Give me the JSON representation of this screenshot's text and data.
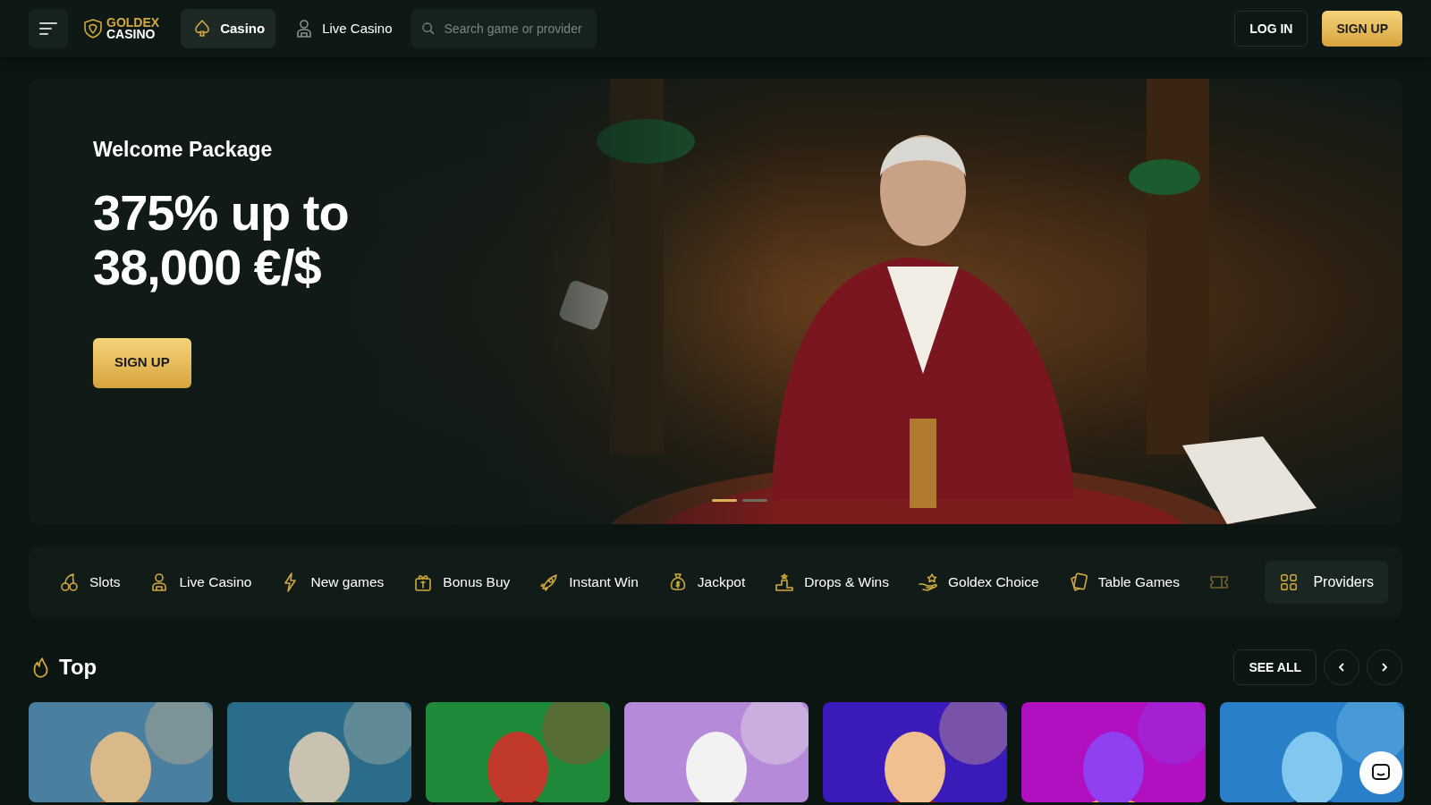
{
  "header": {
    "logo": {
      "line_1": "GOLDEX",
      "line_2": "CASINO"
    },
    "nav": [
      {
        "label": "Casino",
        "selected": true
      },
      {
        "label": "Live Casino",
        "selected": false
      }
    ],
    "search": {
      "placeholder": "Search game or provider"
    },
    "buttons": {
      "login": "LOG IN",
      "signup": "SIGN UP"
    }
  },
  "hero": {
    "eyebrow": "Welcome Package",
    "headline": "375% up to 38,000 €/$",
    "button": "SIGN UP",
    "slides": [
      {
        "selected": true
      },
      {
        "selected": false
      }
    ]
  },
  "categories": [
    {
      "label": "Slots"
    },
    {
      "label": "Live Casino"
    },
    {
      "label": "New games"
    },
    {
      "label": "Bonus Buy"
    },
    {
      "label": "Instant Win"
    },
    {
      "label": "Jackpot"
    },
    {
      "label": "Drops & Wins"
    },
    {
      "label": "Goldex Choice"
    },
    {
      "label": "Table Games"
    }
  ],
  "providers_button": "Providers",
  "section": {
    "title": "Top",
    "see_all": "SEE ALL"
  }
}
